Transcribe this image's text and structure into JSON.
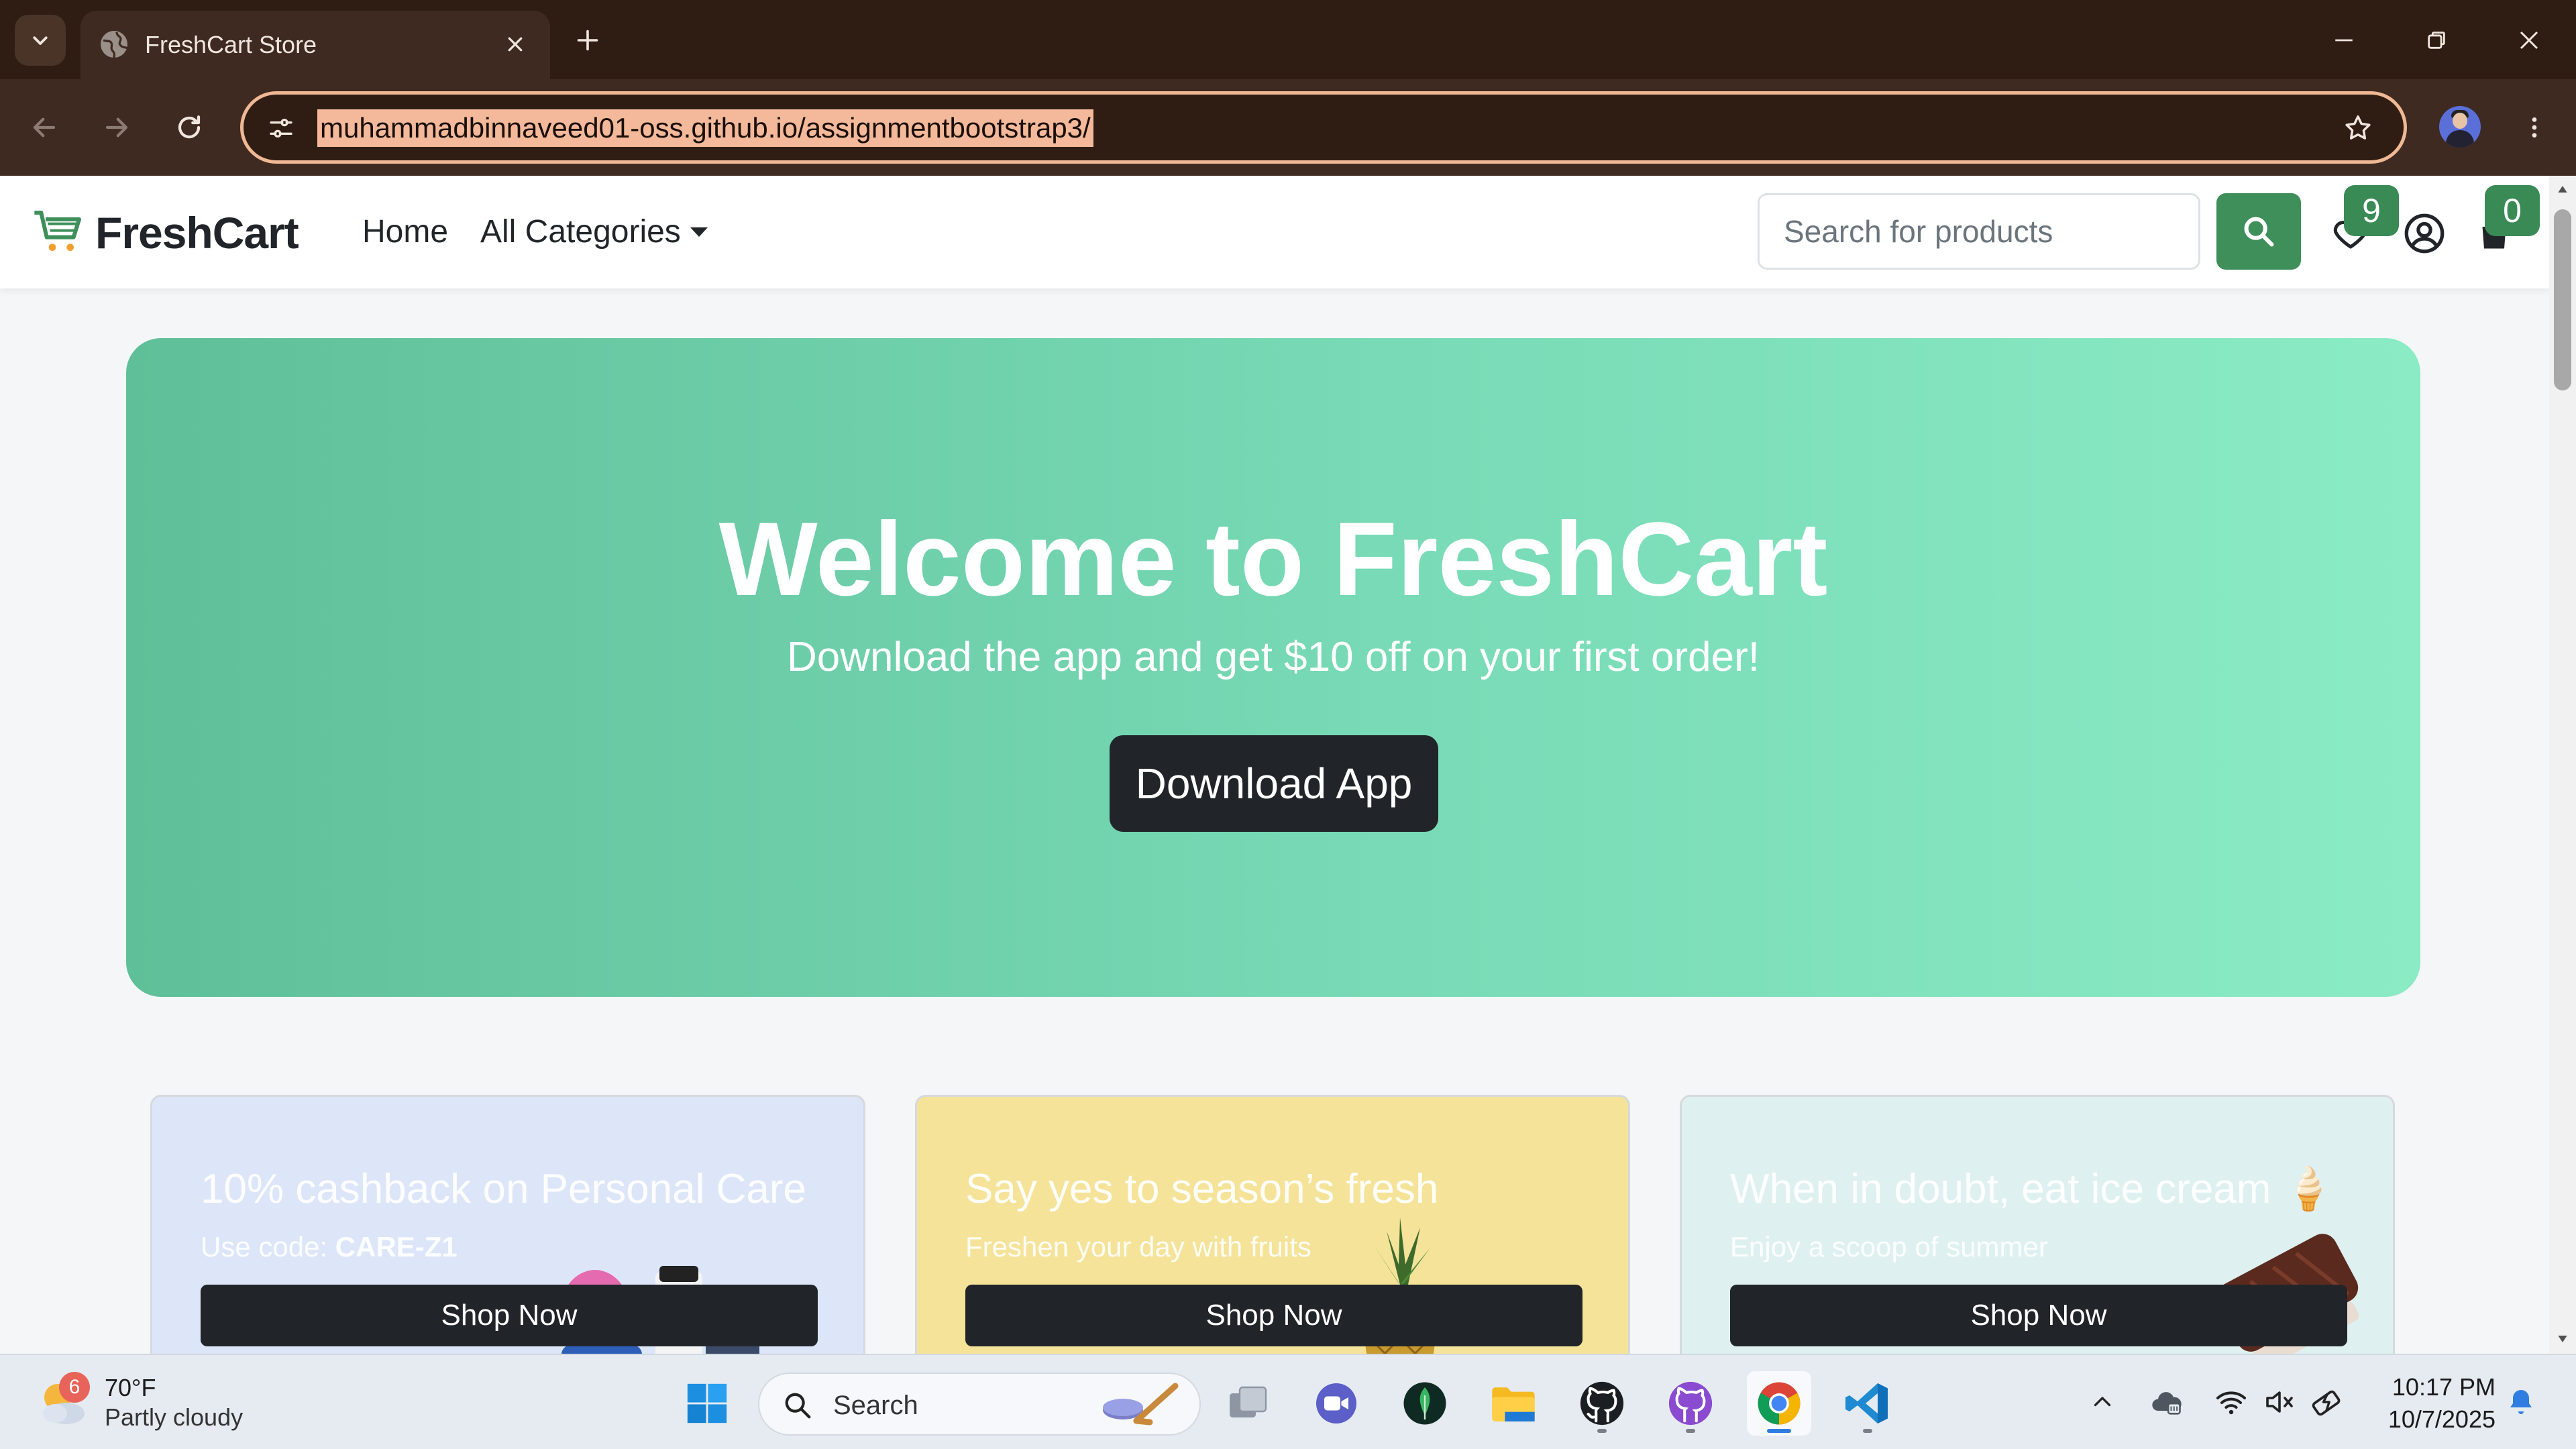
{
  "browser": {
    "tab_title": "FreshCart Store",
    "url": "muhammadbinnaveed01-oss.github.io/assignmentbootstrap3/"
  },
  "site": {
    "brand": "FreshCart",
    "nav": {
      "home": "Home",
      "categories": "All Categories"
    },
    "search_placeholder": "Search for products",
    "wishlist_count": "9",
    "cart_count": "0",
    "hero": {
      "title": "Welcome to FreshCart",
      "subtitle": "Download the app and get $10 off on your first order!",
      "button": "Download App"
    },
    "cards": [
      {
        "title": "10% cashback on Personal Care",
        "sub_prefix": "Use code: ",
        "sub_code": "CARE-Z1",
        "button": "Shop Now",
        "bg": "#dde6f8"
      },
      {
        "title": "Say yes to season’s fresh",
        "sub_prefix": "Freshen your day with fruits",
        "sub_code": "",
        "button": "Shop Now",
        "bg": "#f5e39a"
      },
      {
        "title": "When in doubt, eat ice cream",
        "title_emoji": "🍦",
        "sub_prefix": "Enjoy a scoop of summer",
        "sub_code": "",
        "button": "Shop Now",
        "bg": "#dff0f1"
      }
    ],
    "brand_color": "#3f8f5a"
  },
  "taskbar": {
    "weather_badge": "6",
    "weather_temp": "70°F",
    "weather_desc": "Partly cloudy",
    "search_label": "Search",
    "time": "10:17 PM",
    "date": "10/7/2025"
  }
}
